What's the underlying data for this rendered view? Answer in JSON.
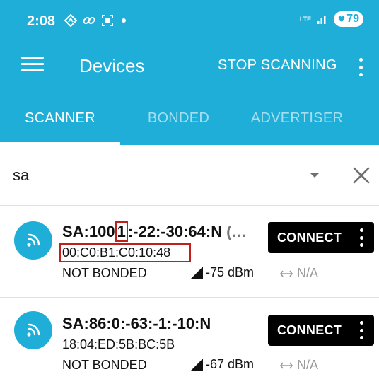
{
  "status_bar": {
    "time": "2:08",
    "network_label": "LTE",
    "battery_level": "79",
    "icons": [
      "location-icon",
      "link-icon",
      "screenshot-icon",
      "notification-dot",
      "signal-bars-icon",
      "battery-icon"
    ]
  },
  "app_bar": {
    "title": "Devices",
    "stop_scanning_label": "STOP SCANNING",
    "icons": [
      "menu-icon",
      "more-vertical-icon"
    ]
  },
  "tabs": [
    {
      "label": "SCANNER",
      "selected": true
    },
    {
      "label": "BONDED",
      "selected": false
    },
    {
      "label": "ADVERTISER",
      "selected": false
    }
  ],
  "filter": {
    "value": "sa",
    "icons": [
      "dropdown-arrow-icon",
      "clear-icon"
    ]
  },
  "devices": [
    {
      "name_start": "SA:100",
      "name_highlight": "1",
      "name_end": ":-22:-30:64:N",
      "name_suffix": "(…",
      "mac": "00:C0:B1:C0:10:48",
      "bond_state": "NOT BONDED",
      "rssi": "-75 dBm",
      "interval": "N/A",
      "connect_label": "CONNECT"
    },
    {
      "name": "SA:86:0:-63:-1:-10:N",
      "mac": "18:04:ED:5B:BC:5B",
      "bond_state": "NOT BONDED",
      "rssi": "-67 dBm",
      "interval": "N/A",
      "connect_label": "CONNECT"
    }
  ],
  "colors": {
    "primary": "#1eaed8",
    "annotation": "#c0201c",
    "button": "#000000"
  }
}
